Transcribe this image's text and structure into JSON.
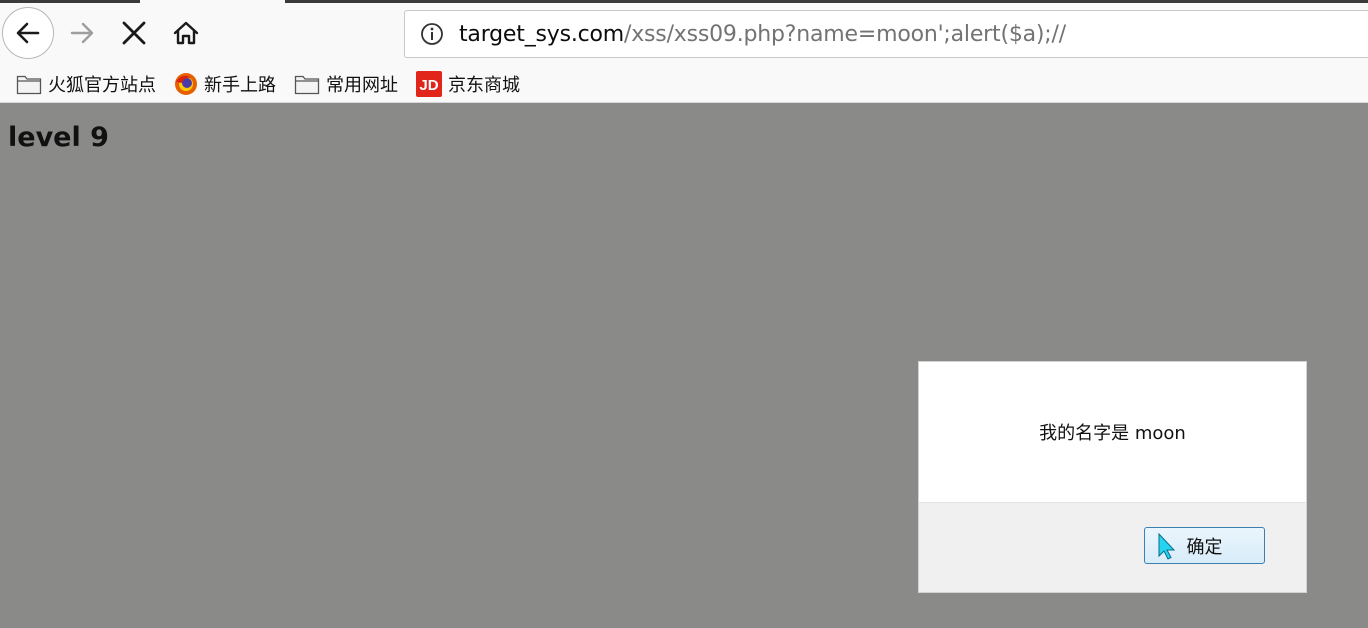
{
  "browser": {
    "url_host": "target_sys.com",
    "url_path": "/xss/xss09.php?name=moon';alert($a);//",
    "icons": [
      "back-arrow-icon",
      "forward-arrow-icon",
      "stop-icon",
      "home-icon",
      "info-icon"
    ]
  },
  "bookmarks": [
    {
      "label": "火狐官方站点",
      "icon": "folder-icon"
    },
    {
      "label": "新手上路",
      "icon": "firefox-icon"
    },
    {
      "label": "常用网址",
      "icon": "folder-icon"
    },
    {
      "label": "京东商城",
      "icon": "jd-icon",
      "icon_text": "JD"
    }
  ],
  "page": {
    "heading": "level 9"
  },
  "dialog": {
    "message": "我的名字是 moon",
    "ok_label": "确定"
  },
  "colors": {
    "page_background": "#8a8b89",
    "toolbar_background": "#f9f9fa",
    "jd_red": "#e1251b",
    "button_border": "#3c7fb1"
  }
}
